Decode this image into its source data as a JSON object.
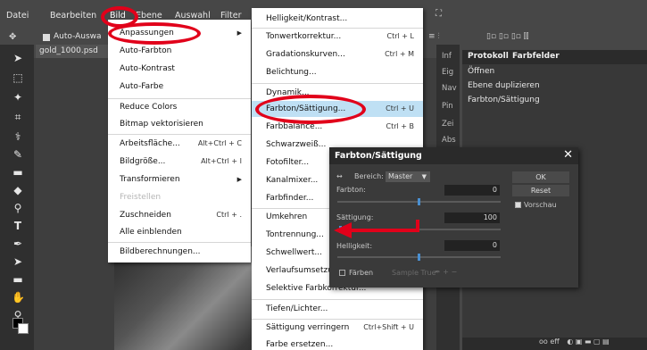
{
  "menubar": {
    "items": [
      "Datei",
      "Bearbeiten",
      "Bild",
      "Ebene",
      "Auswahl",
      "Filter"
    ]
  },
  "options_bar": {
    "auto_select_label": "Auto-Auswa"
  },
  "document": {
    "tab_label": "gold_1000.psd"
  },
  "right_column": {
    "items": [
      "Inf",
      "Eig",
      "Nav",
      "Pin",
      "Zei",
      "Abs"
    ]
  },
  "panel": {
    "tabs": [
      "Protokoll",
      "Farbfelder"
    ],
    "history": [
      "Öffnen",
      "Ebene duplizieren",
      "Farbton/Sättigung"
    ],
    "bottom_text": "oo eff"
  },
  "bild_menu": {
    "items": [
      {
        "label": "Anpassungen",
        "arrow": "▶"
      },
      {
        "label": "Auto-Farbton"
      },
      {
        "label": "Auto-Kontrast"
      },
      {
        "label": "Auto-Farbe"
      },
      {
        "label": "Reduce Colors"
      },
      {
        "label": "Bitmap vektorisieren"
      },
      {
        "label": "Arbeitsfläche...",
        "shortcut": "Alt+Ctrl + C"
      },
      {
        "label": "Bildgröße...",
        "shortcut": "Alt+Ctrl + I"
      },
      {
        "label": "Transformieren",
        "arrow": "▶"
      },
      {
        "label": "Freistellen",
        "disabled": true
      },
      {
        "label": "Zuschneiden",
        "shortcut": "Ctrl + ."
      },
      {
        "label": "Alle einblenden"
      },
      {
        "label": "Bildberechnungen..."
      }
    ]
  },
  "anpassungen_menu": {
    "items": [
      {
        "label": "Helligkeit/Kontrast..."
      },
      {
        "label": "Tonwertkorrektur...",
        "shortcut": "Ctrl + L"
      },
      {
        "label": "Gradationskurven...",
        "shortcut": "Ctrl + M"
      },
      {
        "label": "Belichtung..."
      },
      {
        "label": "Dynamik..."
      },
      {
        "label": "Farbton/Sättigung...",
        "shortcut": "Ctrl + U"
      },
      {
        "label": "Farbbalance...",
        "shortcut": "Ctrl + B"
      },
      {
        "label": "Schwarzweiß..."
      },
      {
        "label": "Fotofilter..."
      },
      {
        "label": "Kanalmixer..."
      },
      {
        "label": "Farbfinder..."
      },
      {
        "label": "Umkehren"
      },
      {
        "label": "Tontrennung..."
      },
      {
        "label": "Schwellwert..."
      },
      {
        "label": "Verlaufsumsetzung..."
      },
      {
        "label": "Selektive Farbkorrektur..."
      },
      {
        "label": "Tiefen/Lichter..."
      },
      {
        "label": "Sättigung verringern",
        "shortcut": "Ctrl+Shift + U"
      },
      {
        "label": "Farbe ersetzen..."
      }
    ]
  },
  "dialog": {
    "title": "Farbton/Sättigung",
    "bereich_label": "Bereich:",
    "bereich_value": "Master",
    "hue_label": "Farbton:",
    "hue_value": "0",
    "sat_label": "Sättigung:",
    "sat_value": "100",
    "light_label": "Helligkeit:",
    "light_value": "0",
    "ok_label": "OK",
    "reset_label": "Reset",
    "preview_label": "Vorschau",
    "colorize_label": "Färben",
    "sample_label": "Sample True"
  },
  "colors": {
    "accent_blue": "#4a8fd0",
    "highlight": "#bfe0f4",
    "annotation_red": "#e1001a"
  }
}
